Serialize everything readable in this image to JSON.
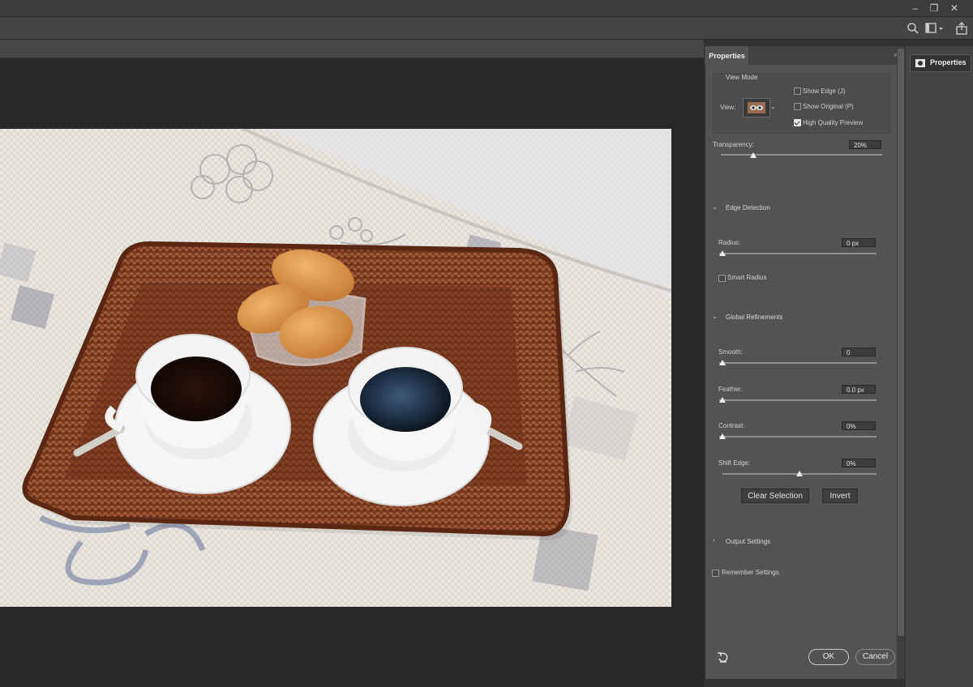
{
  "icons": {
    "minimize": "minimize-icon",
    "restore": "restore-icon",
    "close": "close-icon",
    "search": "search-icon",
    "workspace": "workspace-icon",
    "share": "share-icon",
    "reset": "reset-icon"
  },
  "window_controls": {
    "minimize": "–",
    "restore": "❐",
    "close": "✕"
  },
  "panel": {
    "tab": "Properties",
    "collapse": "»",
    "view_mode": {
      "heading": "View Mode",
      "view_label": "View:",
      "show_edge": {
        "label": "Show Edge (J)",
        "checked": false
      },
      "show_original": {
        "label": "Show Original (P)",
        "checked": false
      },
      "high_quality": {
        "label": "High Quality Preview",
        "checked": true
      }
    },
    "transparency": {
      "label": "Transparency:",
      "value": "20%",
      "level": 0.2
    },
    "edge_detection": {
      "heading": "Edge Detection",
      "radius": {
        "label": "Radius:",
        "value": "0 px",
        "level": 0.0
      },
      "smart_radius": {
        "label": "Smart Radius",
        "checked": false
      }
    },
    "global_refinements": {
      "heading": "Global Refinements",
      "smooth": {
        "label": "Smooth:",
        "value": "0",
        "level": 0.0
      },
      "feather": {
        "label": "Feather:",
        "value": "0.0 px",
        "level": 0.0
      },
      "contrast": {
        "label": "Contrast:",
        "value": "0%",
        "level": 0.0
      },
      "shift_edge": {
        "label": "Shift Edge:",
        "value": "0%",
        "level": 0.5
      }
    },
    "clear_selection": "Clear Selection",
    "invert": "Invert",
    "output_settings": "Output Settings",
    "remember_settings": {
      "label": "Remember Settings",
      "checked": false
    },
    "ok": "OK",
    "cancel": "Cancel"
  },
  "dock": {
    "properties": "Properties"
  },
  "colors": {
    "panel_bg": "#535353",
    "canvas_bg": "#282828",
    "accent_text": "#d0d0d0"
  }
}
